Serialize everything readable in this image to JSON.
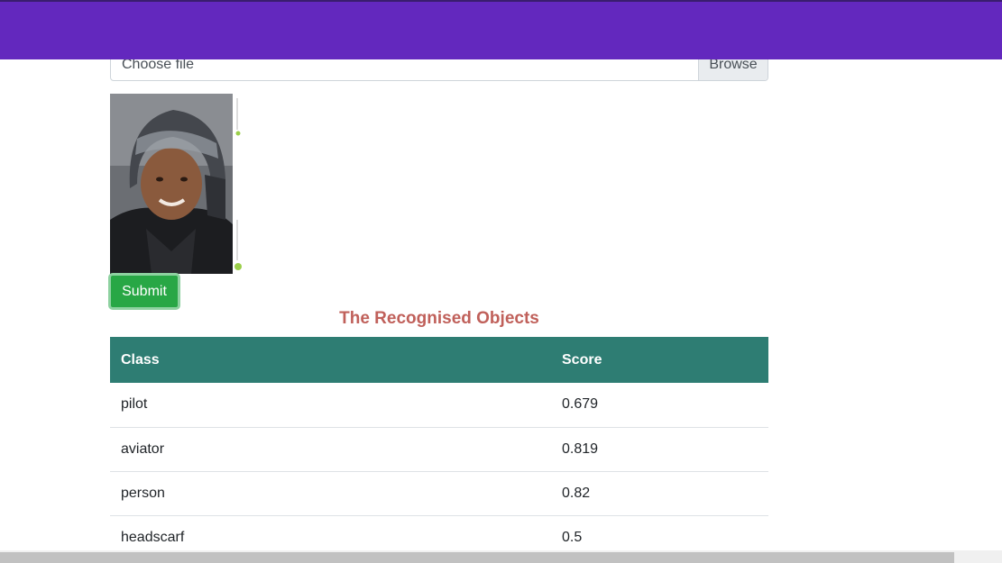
{
  "upload": {
    "placeholder": "Choose file",
    "browse_label": "Browse"
  },
  "form": {
    "submit_label": "Submit"
  },
  "results": {
    "title": "The Recognised Objects",
    "columns": [
      "Class",
      "Score"
    ],
    "rows": [
      {
        "class": "pilot",
        "score": "0.679"
      },
      {
        "class": "aviator",
        "score": "0.819"
      },
      {
        "class": "person",
        "score": "0.82"
      },
      {
        "class": "headscarf",
        "score": "0.5"
      }
    ]
  },
  "colors": {
    "topbar": "#6328be",
    "submit": "#28a745",
    "table_header": "#2e7d73",
    "title": "#c0605a"
  }
}
